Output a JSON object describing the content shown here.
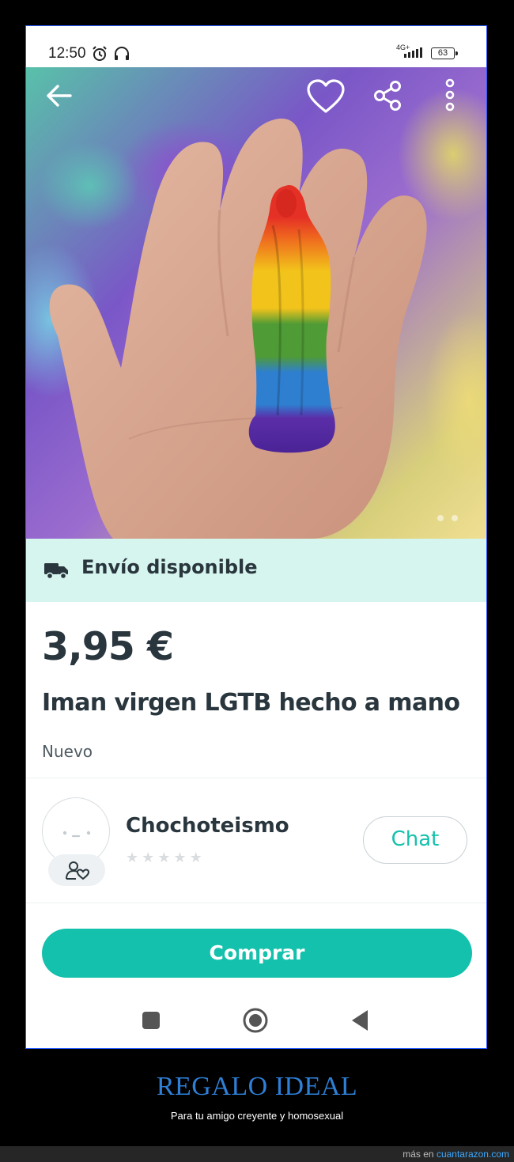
{
  "status_bar": {
    "time": "12:50",
    "network": "4G+",
    "battery": "63"
  },
  "hero": {
    "icons": [
      "back-arrow-icon",
      "heart-icon",
      "share-icon",
      "more-vert-icon"
    ],
    "image_pager_count": 2
  },
  "shipping": {
    "label": "Envío disponible",
    "icon": "truck-icon"
  },
  "product": {
    "price": "3,95 €",
    "title": "Iman virgen LGTB hecho a mano",
    "condition": "Nuevo"
  },
  "seller": {
    "name": "Chochoteismo",
    "rating_stars": 5,
    "rating_filled": 0,
    "chat_label": "Chat"
  },
  "actions": {
    "buy_label": "Comprar"
  },
  "caption": {
    "title": "REGALO IDEAL",
    "subtitle": "Para tu amigo creyente y homosexual"
  },
  "footer": {
    "prefix": "más en ",
    "link": "cuantarazon.com"
  },
  "colors": {
    "accent": "#13c1ac",
    "shipping_bg": "#d6f5ef",
    "text_dark": "#29363d",
    "caption_blue": "#2e7fd6"
  }
}
